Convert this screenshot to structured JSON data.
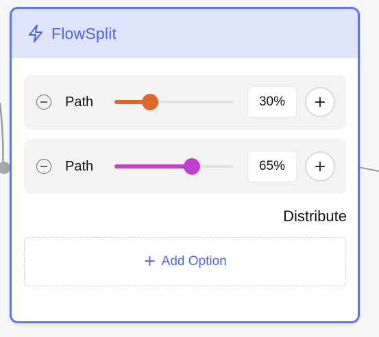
{
  "node": {
    "title": "FlowSplit",
    "icon": "lightning-bolt-icon",
    "accent_color": "#5b74f0"
  },
  "paths": [
    {
      "label": "Path",
      "percent_label": "30%",
      "value": 30,
      "color": "#e0662a"
    },
    {
      "label": "Path",
      "percent_label": "65%",
      "value": 65,
      "color": "#c23ecf"
    }
  ],
  "actions": {
    "distribute_label": "Distribute",
    "add_option_label": "Add Option",
    "plus_glyph": "+"
  }
}
